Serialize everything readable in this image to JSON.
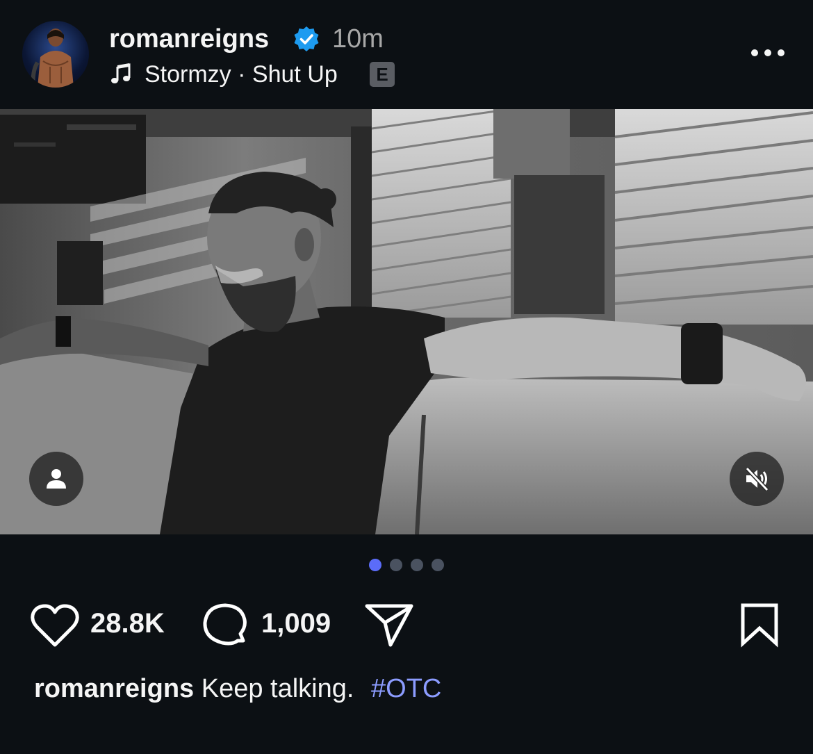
{
  "post": {
    "username": "romanreigns",
    "verified": true,
    "time_ago": "10m",
    "music": {
      "artist_track": "Stormzy · Shut Up",
      "explicit_badge": "E"
    },
    "image_description_icon": "black-and-white-photo",
    "carousel": {
      "count": 4,
      "active_index": 0
    },
    "likes": "28.8K",
    "comments": "1,009",
    "caption": {
      "username": "romanreigns",
      "text": "Keep talking.",
      "hashtag": "#OTC"
    }
  },
  "icons": {
    "verified": "verified-badge-icon",
    "music": "music-note-icon",
    "more": "more-options-icon",
    "tag": "person-tag-icon",
    "mute": "speaker-muted-icon",
    "like": "heart-icon",
    "comment": "comment-bubble-icon",
    "share": "paper-plane-icon",
    "save": "bookmark-icon"
  },
  "colors": {
    "background": "#0c1014",
    "verified": "#1d9bf0",
    "hashtag": "#8c9cff",
    "carousel_active": "#5b6cf9",
    "carousel_inactive": "#4a5260",
    "muted_text": "#a8a8a8"
  }
}
